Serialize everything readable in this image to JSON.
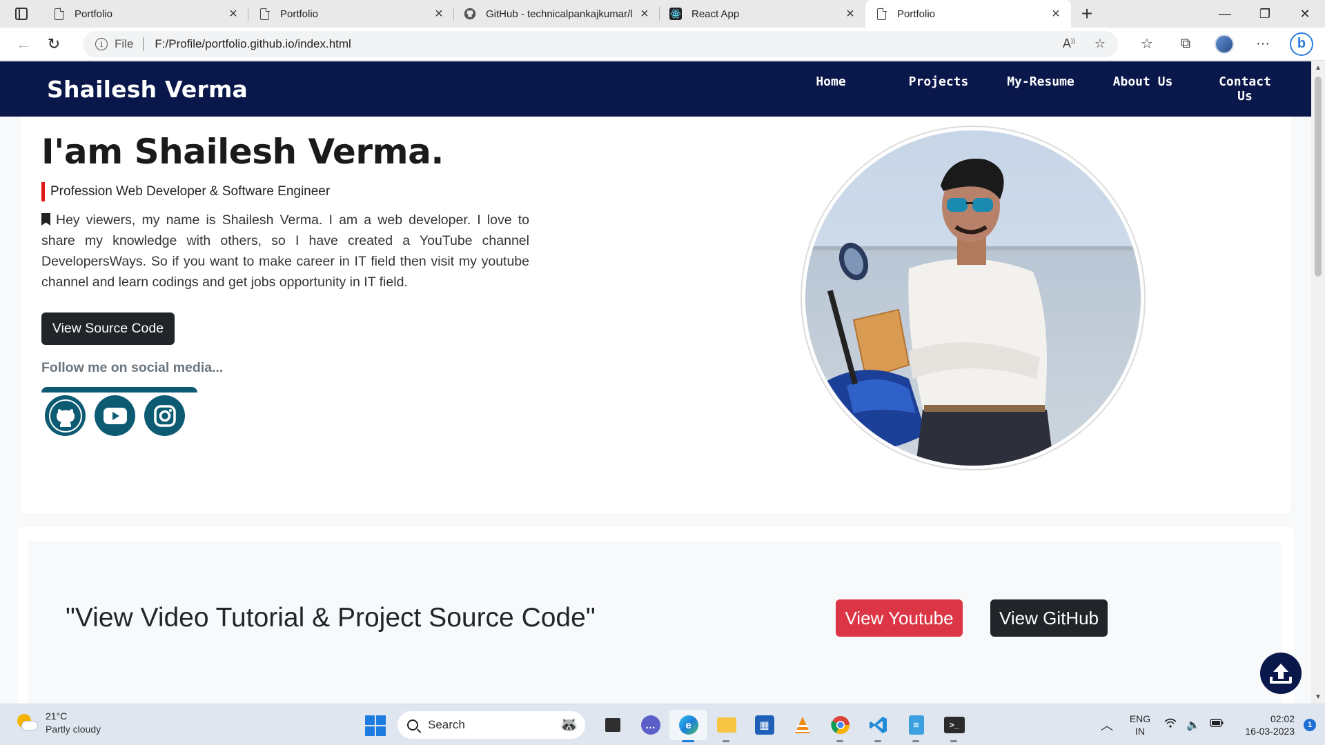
{
  "browser": {
    "tabs": [
      {
        "title": "Portfolio",
        "icon": "page-icon",
        "active": false
      },
      {
        "title": "Portfolio",
        "icon": "page-icon",
        "active": false
      },
      {
        "title": "GitHub - technicalpankajkumar/l",
        "icon": "github-icon",
        "active": false
      },
      {
        "title": "React App",
        "icon": "react-icon",
        "active": false
      },
      {
        "title": "Portfolio",
        "icon": "page-icon",
        "active": true
      }
    ],
    "address": {
      "scheme_label": "File",
      "url": "F:/Profile/portfolio.github.io/index.html"
    }
  },
  "site": {
    "brand": "Shailesh Verma",
    "nav": [
      "Home",
      "Projects",
      "My-Resume",
      "About Us",
      "Contact Us"
    ],
    "hero": {
      "heading": "I'am Shailesh Verma.",
      "profession": "Profession Web Developer & Software Engineer",
      "bio": "Hey viewers, my name is Shailesh Verma. I am a web developer. I love to share my knowledge with others, so I have created a YouTube channel DevelopersWays. So if you want to make career in IT field then visit my youtube channel and learn codings and get jobs opportunity in IT field.",
      "source_button": "View Source Code",
      "follow_text": "Follow me on social media...",
      "socials": [
        "github-icon",
        "youtube-icon",
        "instagram-icon"
      ]
    },
    "cta": {
      "text": "\"View Video Tutorial & Project Source Code\"",
      "youtube_button": "View Youtube",
      "github_button": "View GitHub"
    },
    "colors": {
      "navbar": "#09174a",
      "accent_red": "#dc3545",
      "social_teal": "#0d5b72",
      "dark_button": "#212529"
    }
  },
  "taskbar": {
    "weather": {
      "temp": "21°C",
      "condition": "Partly cloudy"
    },
    "search_label": "Search",
    "apps": [
      "file-explorer-icon",
      "chat-icon",
      "edge-icon",
      "folder-icon",
      "store-icon",
      "vlc-icon",
      "chrome-icon",
      "vscode-icon",
      "notepad-icon",
      "terminal-icon"
    ],
    "lang": {
      "line1": "ENG",
      "line2": "IN"
    },
    "time": "02:02",
    "date": "16-03-2023",
    "notification_count": "1"
  }
}
